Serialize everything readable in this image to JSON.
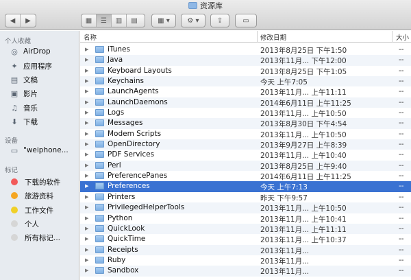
{
  "window": {
    "title": "资源库"
  },
  "toolbar": {
    "back_icon": "chevron-left-icon",
    "forward_icon": "chevron-right-icon",
    "view_modes": [
      "icon-view-icon",
      "list-view-icon",
      "column-view-icon",
      "coverflow-view-icon"
    ],
    "arrange_icon": "grid-icon",
    "action_icon": "gear-icon",
    "share_icon": "share-icon",
    "tag_icon": "tag-icon"
  },
  "sidebar": {
    "favorites_header": "个人收藏",
    "favorites": [
      {
        "label": "AirDrop",
        "icon": "airdrop-icon"
      },
      {
        "label": "应用程序",
        "icon": "applications-icon"
      },
      {
        "label": "文稿",
        "icon": "documents-icon"
      },
      {
        "label": "影片",
        "icon": "movies-icon"
      },
      {
        "label": "音乐",
        "icon": "music-icon"
      },
      {
        "label": "下载",
        "icon": "downloads-icon"
      }
    ],
    "devices_header": "设备",
    "devices": [
      {
        "label": "\"weiphone...",
        "icon": "computer-icon"
      }
    ],
    "tags_header": "标记",
    "tags": [
      {
        "label": "下载的软件",
        "color": "#f25a5a"
      },
      {
        "label": "旅游资料",
        "color": "#f5a623"
      },
      {
        "label": "工作文件",
        "color": "#f0d028"
      },
      {
        "label": "个人",
        "color": "#d6d6d6"
      },
      {
        "label": "所有标记...",
        "color": "#d6d6d6"
      }
    ]
  },
  "list": {
    "headers": {
      "name": "名称",
      "date": "修改日期",
      "size": "大小"
    },
    "accent": "#3a72d2",
    "rows": [
      {
        "name": "iTunes",
        "date": "2013年8月25日 下午1:50",
        "size": "--"
      },
      {
        "name": "Java",
        "date": "2013年11月... 下午12:00",
        "size": "--"
      },
      {
        "name": "Keyboard Layouts",
        "date": "2013年8月25日 下午1:05",
        "size": "--"
      },
      {
        "name": "Keychains",
        "date": "今天 上午7:05",
        "size": "--"
      },
      {
        "name": "LaunchAgents",
        "date": "2013年11月... 上午11:11",
        "size": "--"
      },
      {
        "name": "LaunchDaemons",
        "date": "2014年6月11日 上午11:25",
        "size": "--"
      },
      {
        "name": "Logs",
        "date": "2013年11月... 上午10:50",
        "size": "--"
      },
      {
        "name": "Messages",
        "date": "2013年8月30日 下午4:54",
        "size": "--"
      },
      {
        "name": "Modem Scripts",
        "date": "2013年11月... 上午10:50",
        "size": "--"
      },
      {
        "name": "OpenDirectory",
        "date": "2013年9月27日 上午8:39",
        "size": "--"
      },
      {
        "name": "PDF Services",
        "date": "2013年11月... 上午10:40",
        "size": "--"
      },
      {
        "name": "Perl",
        "date": "2013年8月25日 上午9:40",
        "size": "--"
      },
      {
        "name": "PreferencePanes",
        "date": "2014年6月11日 上午11:25",
        "size": "--"
      },
      {
        "name": "Preferences",
        "date": "今天 上午7:13",
        "size": "--"
      },
      {
        "name": "Printers",
        "date": "昨天 下午9:57",
        "size": "--"
      },
      {
        "name": "PrivilegedHelperTools",
        "date": "2013年11月... 上午10:50",
        "size": "--"
      },
      {
        "name": "Python",
        "date": "2013年11月... 上午10:41",
        "size": "--"
      },
      {
        "name": "QuickLook",
        "date": "2013年11月... 上午11:11",
        "size": "--"
      },
      {
        "name": "QuickTime",
        "date": "2013年11月... 上午10:37",
        "size": "--"
      },
      {
        "name": "Receipts",
        "date": "2013年11月...",
        "size": "--"
      },
      {
        "name": "Ruby",
        "date": "2013年11月...",
        "size": "--"
      },
      {
        "name": "Sandbox",
        "date": "2013年11月...",
        "size": "--"
      }
    ],
    "selected_row": "Preferences"
  }
}
